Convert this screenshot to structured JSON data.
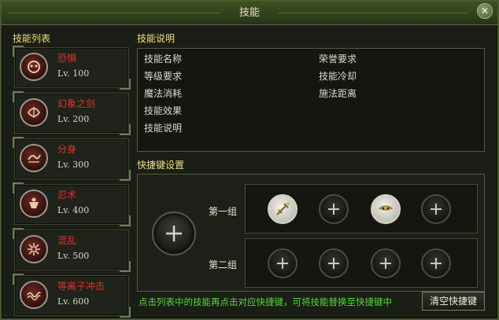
{
  "window": {
    "title": "技能",
    "close_label": "✕"
  },
  "skill_list": {
    "title": "技能列表",
    "items": [
      {
        "name": "恐惧",
        "level": "Lv. 100",
        "icon": "fear-skill-icon"
      },
      {
        "name": "幻象之剑",
        "level": "Lv. 200",
        "icon": "illusion-sword-skill-icon"
      },
      {
        "name": "分身",
        "level": "Lv. 300",
        "icon": "clone-skill-icon"
      },
      {
        "name": "忍术",
        "level": "Lv. 400",
        "icon": "ninjutsu-skill-icon"
      },
      {
        "name": "混乱",
        "level": "Lv. 500",
        "icon": "chaos-skill-icon"
      },
      {
        "name": "等离子冲击",
        "level": "Lv. 600",
        "icon": "plasma-strike-skill-icon"
      }
    ]
  },
  "description": {
    "title": "技能说明",
    "left_rows": [
      "技能名称",
      "等级要求",
      "魔法消耗",
      "技能效果",
      "技能说明"
    ],
    "right_rows": [
      "荣誉要求",
      "技能冷却",
      "施法距离"
    ]
  },
  "hotkeys": {
    "title": "快捷键设置",
    "group1_label": "第一组",
    "group2_label": "第二组",
    "group1_slots": [
      "sword-skill-icon",
      "plus-icon",
      "mask-skill-icon",
      "plus-icon"
    ],
    "group2_slots": [
      "plus-icon",
      "plus-icon",
      "plus-icon",
      "plus-icon"
    ]
  },
  "footer": {
    "hint": "点击列表中的技能再点击对应快捷键，可将技能替换至快捷键中",
    "clear_button": "清空快捷键"
  },
  "colors": {
    "skill_name": "#e0322a",
    "section_title": "#e9e27a",
    "hint_text": "#56d83a",
    "frame_green": "#4a5a2e"
  }
}
